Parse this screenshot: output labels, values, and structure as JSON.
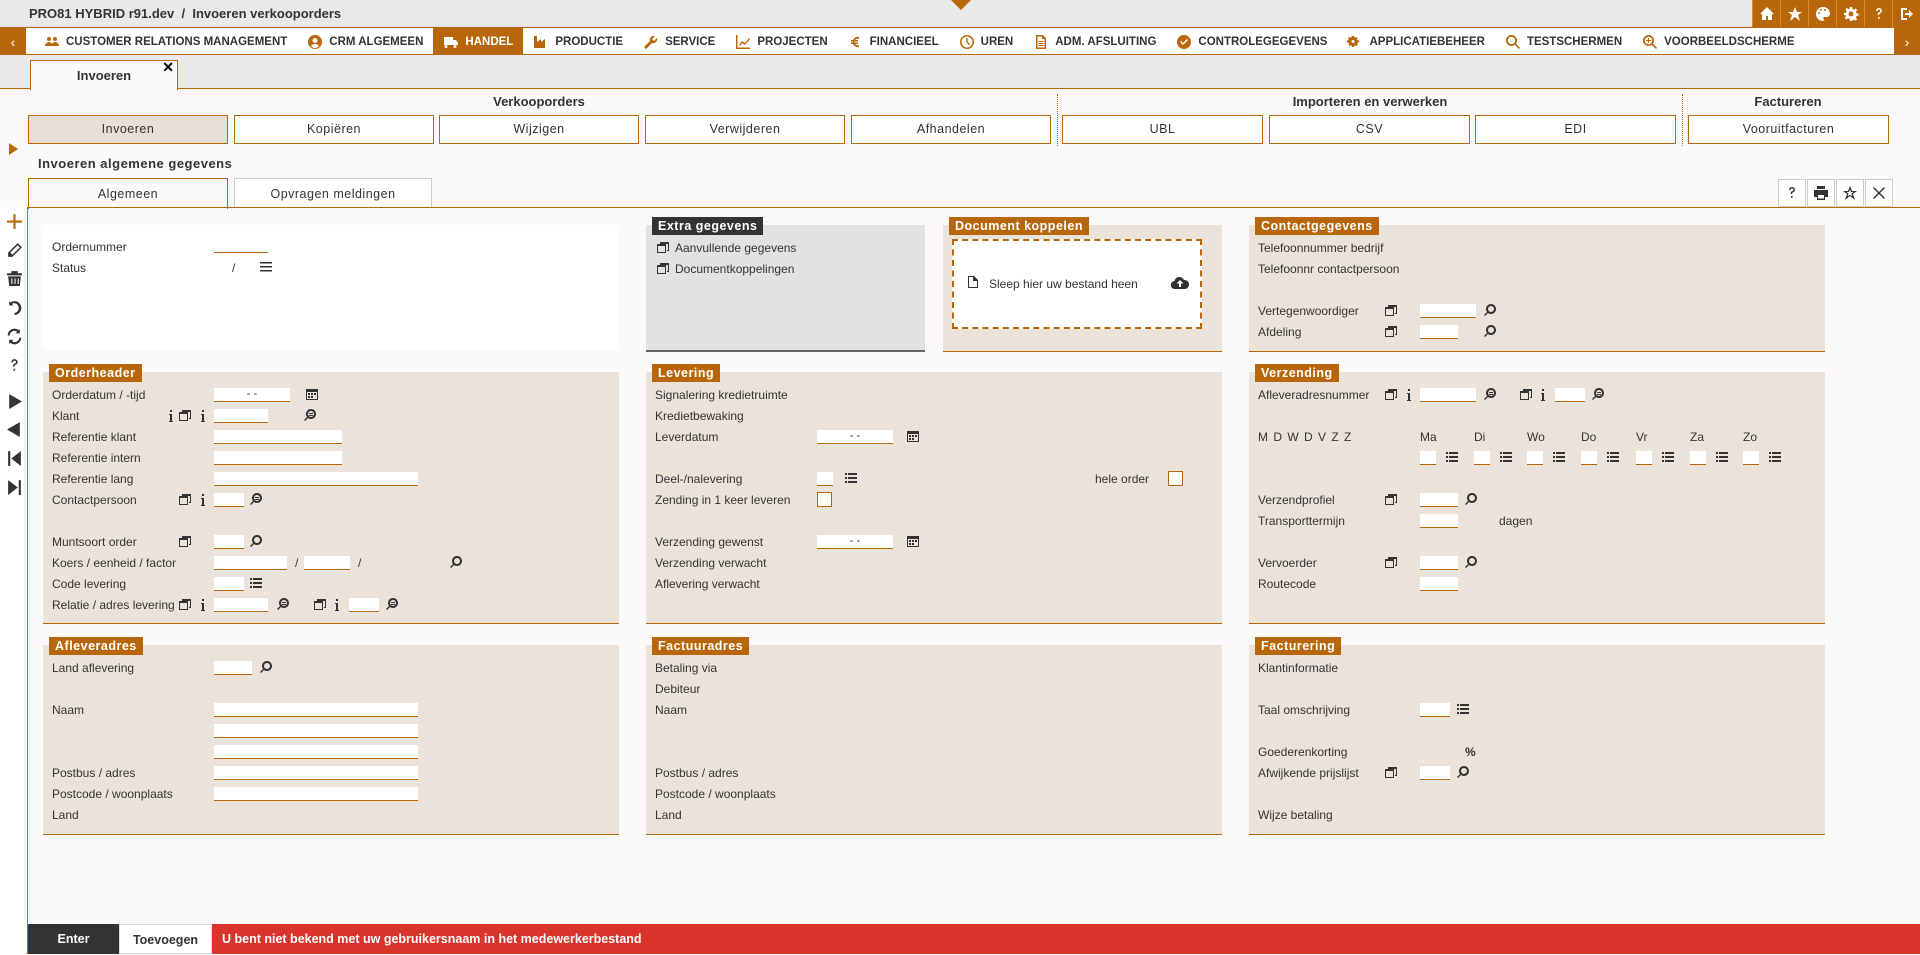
{
  "app": {
    "title": "PRO81 HYBRID r91.dev",
    "separator": "/",
    "page": "Invoeren verkooporders",
    "top_icons": [
      "home-icon",
      "star-icon",
      "palette-icon",
      "gear-icon",
      "help-icon",
      "logout-icon"
    ]
  },
  "nav": {
    "items": [
      {
        "label": "Customer Relations Management",
        "icon": "users-icon",
        "active": false
      },
      {
        "label": "CRM Algemeen",
        "icon": "user-circle-icon",
        "active": false
      },
      {
        "label": "Handel",
        "icon": "truck-icon",
        "active": true
      },
      {
        "label": "Productie",
        "icon": "factory-icon",
        "active": false
      },
      {
        "label": "Service",
        "icon": "wrench-icon",
        "active": false
      },
      {
        "label": "Projecten",
        "icon": "chart-line-icon",
        "active": false
      },
      {
        "label": "Financieel",
        "icon": "euro-icon",
        "active": false
      },
      {
        "label": "Uren",
        "icon": "clock-icon",
        "active": false
      },
      {
        "label": "Adm. afsluiting",
        "icon": "document-icon",
        "active": false
      },
      {
        "label": "Controlegegevens",
        "icon": "check-circle-icon",
        "active": false
      },
      {
        "label": "Applicatiebeheer",
        "icon": "cogs-icon",
        "active": false
      },
      {
        "label": "Testschermen",
        "icon": "search-icon",
        "active": false
      },
      {
        "label": "Voorbeeldscherme",
        "icon": "search-plus-icon",
        "active": false
      }
    ]
  },
  "page_tab": {
    "label": "Invoeren",
    "close": "✕"
  },
  "action_groups": {
    "verkooporders": "Verkooporders",
    "importeren": "Importeren en verwerken",
    "factureren": "Factureren"
  },
  "actions": [
    "Invoeren",
    "Kopiëren",
    "Wijzigen",
    "Verwijderen",
    "Afhandelen",
    "UBL",
    "CSV",
    "EDI",
    "Vooruitfacturen"
  ],
  "section_title": "Invoeren algemene gegevens",
  "subtabs": [
    "Algemeen",
    "Opvragen meldingen"
  ],
  "window_icons": [
    "help-icon",
    "print-icon",
    "star-outline-icon",
    "close-icon"
  ],
  "left_tools": [
    "plus-icon",
    "pencil-icon",
    "trash-icon",
    "undo-icon",
    "refresh-icon",
    "help-icon",
    "play-icon",
    "back-icon",
    "first-icon",
    "last-icon"
  ],
  "general": {
    "ordernummer": "Ordernummer",
    "status": "Status",
    "status_value": "/"
  },
  "extra": {
    "title": "Extra gegevens",
    "links": [
      "Aanvullende gegevens",
      "Documentkoppelingen"
    ]
  },
  "document": {
    "title": "Document koppelen",
    "drop_text": "Sleep hier uw bestand heen"
  },
  "contact": {
    "title": "Contactgegevens",
    "tel_bedrijf": "Telefoonnummer bedrijf",
    "tel_contact": "Telefoonnr contactpersoon",
    "vertegenwoordiger": "Vertegenwoordiger",
    "afdeling": "Afdeling"
  },
  "orderheader": {
    "title": "Orderheader",
    "orderdatum": "Orderdatum / -tijd",
    "date_placeholder": "-   -",
    "klant": "Klant",
    "ref_klant": "Referentie klant",
    "ref_intern": "Referentie intern",
    "ref_lang": "Referentie lang",
    "contactpersoon": "Contactpersoon",
    "muntsoort": "Muntsoort order",
    "koers": "Koers / eenheid / factor",
    "slash": "/",
    "code_levering": "Code levering",
    "relatie": "Relatie / adres levering"
  },
  "levering": {
    "title": "Levering",
    "signalering": "Signalering kredietruimte",
    "kredietbewaking": "Kredietbewaking",
    "leverdatum": "Leverdatum",
    "date_placeholder": "-   -",
    "deel": "Deel-/nalevering",
    "hele_order": "hele order",
    "zending": "Zending in 1 keer leveren",
    "gewenst": "Verzending gewenst",
    "verwacht": "Verzending verwacht",
    "aflevering": "Aflevering verwacht"
  },
  "verzending": {
    "title": "Verzending",
    "afleveradres": "Afleveradresnummer",
    "day_letters": "M  D  W  D  V  Z  Z",
    "days": [
      "Ma",
      "Di",
      "Wo",
      "Do",
      "Vr",
      "Za",
      "Zo"
    ],
    "verzendprofiel": "Verzendprofiel",
    "transporttermijn": "Transporttermijn",
    "dagen": "dagen",
    "vervoerder": "Vervoerder",
    "routecode": "Routecode"
  },
  "afleveradres": {
    "title": "Afleveradres",
    "land_aflevering": "Land aflevering",
    "naam": "Naam",
    "postbus": "Postbus / adres",
    "postcode": "Postcode / woonplaats",
    "land": "Land"
  },
  "factuuradres": {
    "title": "Factuuradres",
    "betaling": "Betaling via",
    "debiteur": "Debiteur",
    "naam": "Naam",
    "postbus": "Postbus / adres",
    "postcode": "Postcode / woonplaats",
    "land": "Land"
  },
  "facturering": {
    "title": "Facturering",
    "klantinfo": "Klantinformatie",
    "taal": "Taal omschrijving",
    "korting": "Goederenkorting",
    "percent": "%",
    "prijslijst": "Afwijkende prijslijst",
    "betaalwijze": "Wijze betaling"
  },
  "footer": {
    "enter": "Enter",
    "toevoegen": "Toevoegen",
    "error": "U bent niet bekend met uw gebruikersnaam in het medewerkerbestand"
  },
  "colors": {
    "accent": "#b8660a",
    "panel": "#ebe3da",
    "error": "#d9342b",
    "dark": "#333333"
  }
}
